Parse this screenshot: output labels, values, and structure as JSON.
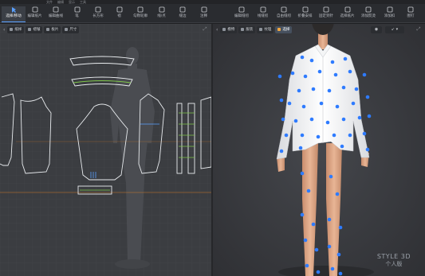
{
  "menubar": {
    "items": [
      "文件",
      "编辑",
      "显示",
      "工具"
    ]
  },
  "toolbar_left": [
    {
      "label": "选择/移动",
      "icon": "cursor-icon",
      "active": true
    },
    {
      "label": "编辑纸片",
      "icon": "edit-piece-icon"
    },
    {
      "label": "编辑曲线",
      "icon": "edit-curve-icon"
    },
    {
      "label": "笔",
      "icon": "pen-icon"
    },
    {
      "label": "长方形",
      "icon": "rectangle-icon"
    },
    {
      "label": "褶",
      "icon": "pleat-icon"
    },
    {
      "label": "勾勒轮廓",
      "icon": "trace-icon"
    },
    {
      "label": "线/点",
      "icon": "line-point-icon"
    },
    {
      "label": "缝边",
      "icon": "seam-allowance-icon"
    },
    {
      "label": "注释",
      "icon": "annotation-icon"
    }
  ],
  "toolbar_right": [
    {
      "label": "编辑缝纫",
      "icon": "edit-sewing-icon"
    },
    {
      "label": "线缝纫",
      "icon": "line-sewing-icon"
    },
    {
      "label": "自由缝纫",
      "icon": "free-sewing-icon"
    },
    {
      "label": "折叠安排",
      "icon": "fold-arrange-icon"
    },
    {
      "label": "固定到针",
      "icon": "pin-icon"
    },
    {
      "label": "选择纸片",
      "icon": "select-piece-icon"
    },
    {
      "label": "添加熨烫",
      "icon": "press-icon"
    },
    {
      "label": "添加扣",
      "icon": "button-icon"
    },
    {
      "label": "图钉",
      "icon": "tack-icon"
    }
  ],
  "left_subbar": [
    {
      "label": "纸样",
      "icon": "pattern-icon"
    },
    {
      "label": "褶皱",
      "icon": "wrinkle-icon"
    },
    {
      "label": "板片",
      "icon": "piece-icon"
    },
    {
      "label": "尺寸",
      "icon": "size-icon"
    }
  ],
  "right_subbar": [
    {
      "label": "模特",
      "icon": "avatar-icon"
    },
    {
      "label": "服装",
      "icon": "garment-icon"
    },
    {
      "label": "纹理",
      "icon": "texture-icon"
    },
    {
      "label": "选择",
      "icon": "select-icon",
      "active": true
    }
  ],
  "watermark": {
    "line1": "STYLE 3D",
    "line2": "个人版"
  }
}
